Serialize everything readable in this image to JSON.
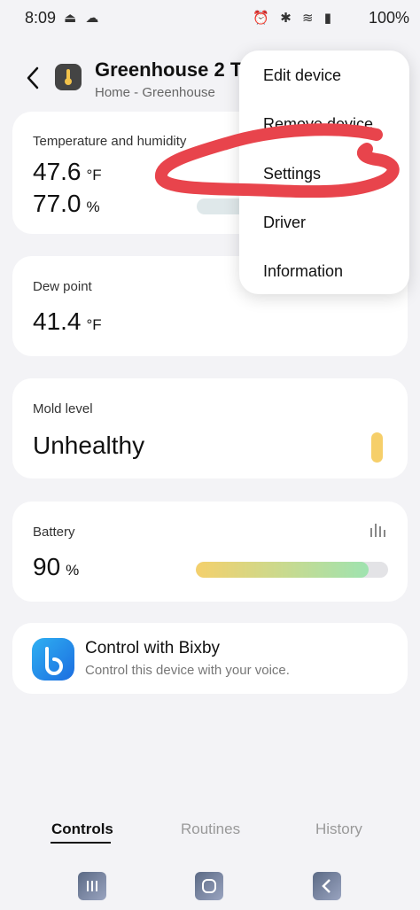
{
  "status_bar": {
    "time": "8:09",
    "left_icons": "⏏ ☁",
    "right_icons": "⏰ ✱ ≋ ▮",
    "battery": "100%"
  },
  "header": {
    "title": "Greenhouse 2 T",
    "subtitle": "Home - Greenhouse"
  },
  "cards": {
    "temperature": {
      "label": "Temperature and humidity",
      "temp_value": "47.6",
      "temp_unit": "°F",
      "humidity_value": "77.0",
      "humidity_unit": "%"
    },
    "dew_point": {
      "label": "Dew point",
      "value": "41.4",
      "unit": "°F"
    },
    "mold": {
      "label": "Mold level",
      "value": "Unhealthy",
      "indicator_color": "#f6cf6a"
    },
    "battery": {
      "label": "Battery",
      "value": "90",
      "unit": "%",
      "level_percent": 90
    }
  },
  "bixby": {
    "title": "Control with Bixby",
    "subtitle": "Control this device with your voice."
  },
  "menu": {
    "items": [
      "Edit device",
      "Remove device",
      "Settings",
      "Driver",
      "Information"
    ]
  },
  "tabs": [
    "Controls",
    "Routines",
    "History"
  ],
  "active_tab": "Controls",
  "annotation": {
    "color": "#e8444c"
  }
}
